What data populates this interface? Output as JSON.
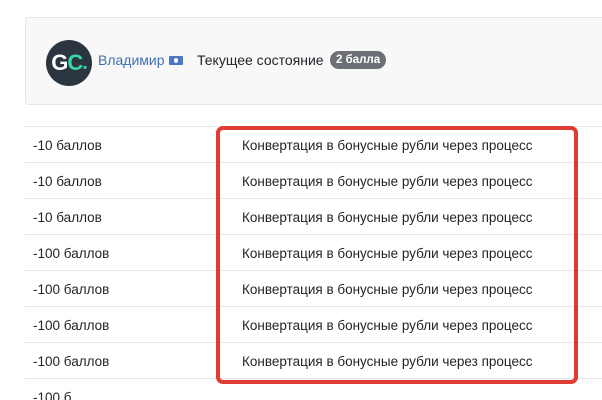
{
  "user": {
    "avatar_initials": "GC",
    "name": "Владимир",
    "status_label": "Текущее состояние",
    "status_badge": "2 балла"
  },
  "transactions": [
    {
      "points": "-10 баллов",
      "description": "Конвертация в бонусные рубли через процесс"
    },
    {
      "points": "-10 баллов",
      "description": "Конвертация в бонусные рубли через процесс"
    },
    {
      "points": "-10 баллов",
      "description": "Конвертация в бонусные рубли через процесс"
    },
    {
      "points": "-100 баллов",
      "description": "Конвертация в бонусные рубли через процесс"
    },
    {
      "points": "-100 баллов",
      "description": "Конвертация в бонусные рубли через процесс"
    },
    {
      "points": "-100 баллов",
      "description": "Конвертация в бонусные рубли через процесс"
    },
    {
      "points": "-100 баллов",
      "description": "Конвертация в бонусные рубли через процесс"
    },
    {
      "points": "-100 б",
      "description": ""
    }
  ],
  "colors": {
    "accent_link": "#3d6fb6",
    "highlight": "#e03c31",
    "badge": "#6c6f73"
  }
}
